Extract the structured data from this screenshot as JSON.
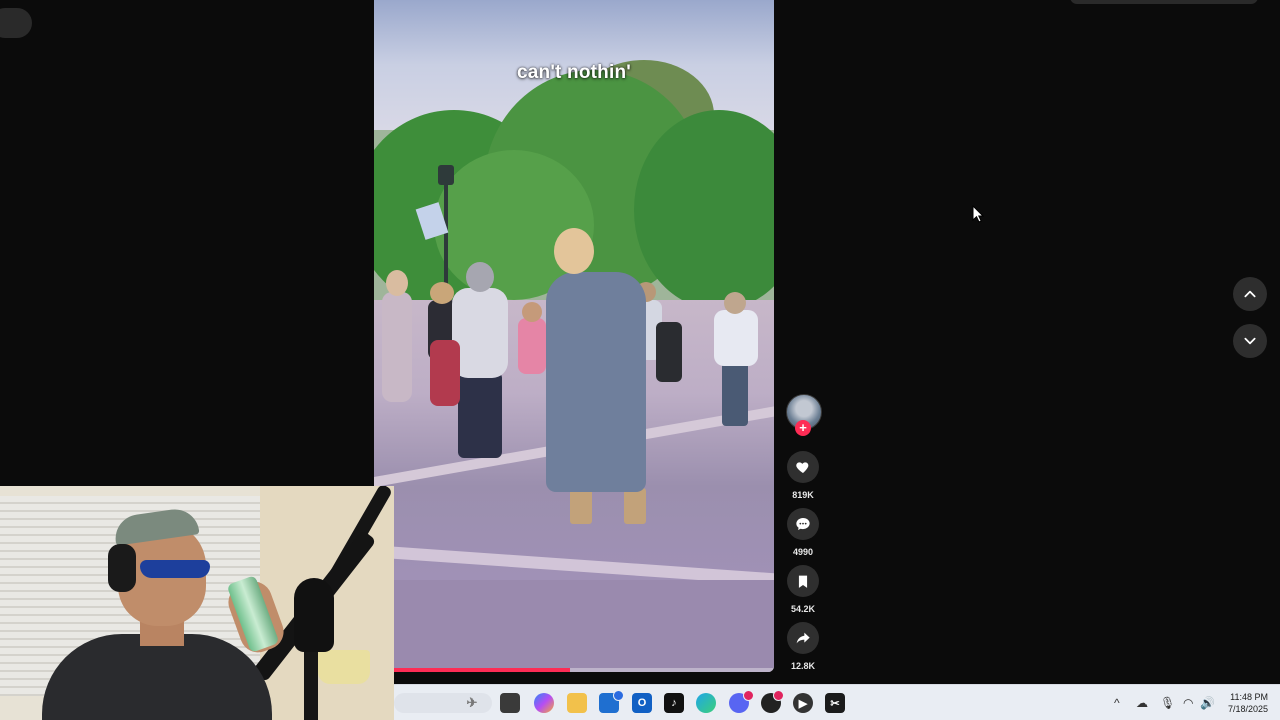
{
  "video": {
    "caption": "can't nothin'",
    "progress_percent": 49
  },
  "actions": {
    "likes": "819K",
    "comments": "4990",
    "saves": "54.2K",
    "shares": "12.8K",
    "follow_symbol": "+"
  },
  "icons": {
    "like": "heart-icon",
    "comment": "comment-icon",
    "save": "bookmark-icon",
    "share": "share-icon",
    "prev": "chevron-up-icon",
    "next": "chevron-down-icon"
  },
  "colors": {
    "accent": "#fe2c55",
    "background": "#0b0b0b",
    "taskbar": "#e9edf3"
  },
  "taskbar": {
    "tray_chevron": "^",
    "time": "11:48 PM",
    "date": "7/18/2025"
  }
}
